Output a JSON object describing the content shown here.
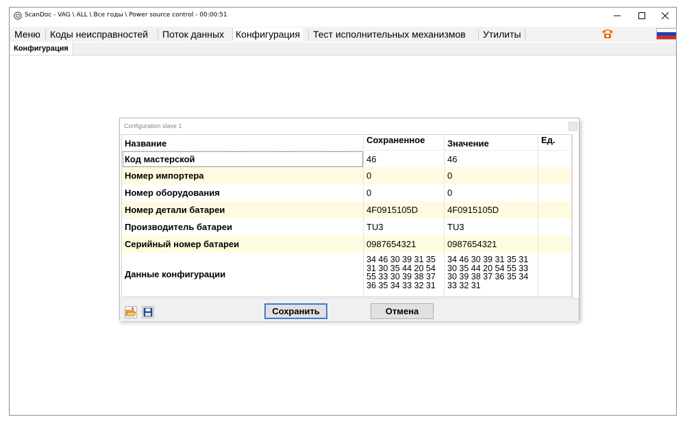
{
  "window": {
    "title": "ScanDoc - VAG \\ ALL \\ Все годы \\ Power source control - 00:00:51"
  },
  "menu": {
    "items": [
      "Меню",
      "Коды неисправностей",
      "Поток данных",
      "Конфигурация",
      "Тест исполнительных механизмов",
      "Утилиты"
    ],
    "active": "Конфигурация"
  },
  "subtab": {
    "label": "Конфигурация"
  },
  "dialog": {
    "title": "Configuration slave 1",
    "columns": [
      "Название",
      "Сохраненное",
      "Значение",
      "Ед."
    ],
    "rows": [
      {
        "name": "Код мастерской",
        "saved": "46",
        "value": "46",
        "unit": ""
      },
      {
        "name": "Номер импортера",
        "saved": "0",
        "value": "0",
        "unit": ""
      },
      {
        "name": "Номер оборудования",
        "saved": "0",
        "value": "0",
        "unit": ""
      },
      {
        "name": "Номер детали батареи",
        "saved": "4F0915105D",
        "value": "4F0915105D",
        "unit": ""
      },
      {
        "name": "Производитель батареи",
        "saved": "TU3",
        "value": "TU3",
        "unit": ""
      },
      {
        "name": "Серийный номер батареи",
        "saved": "0987654321",
        "value": "0987654321",
        "unit": ""
      },
      {
        "name": "Данные конфигурации",
        "saved": "34 46 30 39 31 35\n31 30 35 44 20 54\n55 33 30 39 38 37\n36 35 34 33 32 31",
        "value": "34 46 30 39 31 35 31\n30 35 44 20 54 55 33\n30 39 38 37 36 35 34\n33 32 31",
        "unit": ""
      }
    ],
    "save_label": "Сохранить",
    "cancel_label": "Отмена"
  },
  "colors": {
    "row_highlight": "#fffbe0",
    "primary_border": "#3a7bd5",
    "phone_icon": "#e8710a"
  },
  "icons": [
    "app-icon",
    "minimize-icon",
    "maximize-icon",
    "close-icon",
    "phone-icon",
    "russian-flag-icon",
    "open-folder-icon",
    "save-disk-icon"
  ]
}
